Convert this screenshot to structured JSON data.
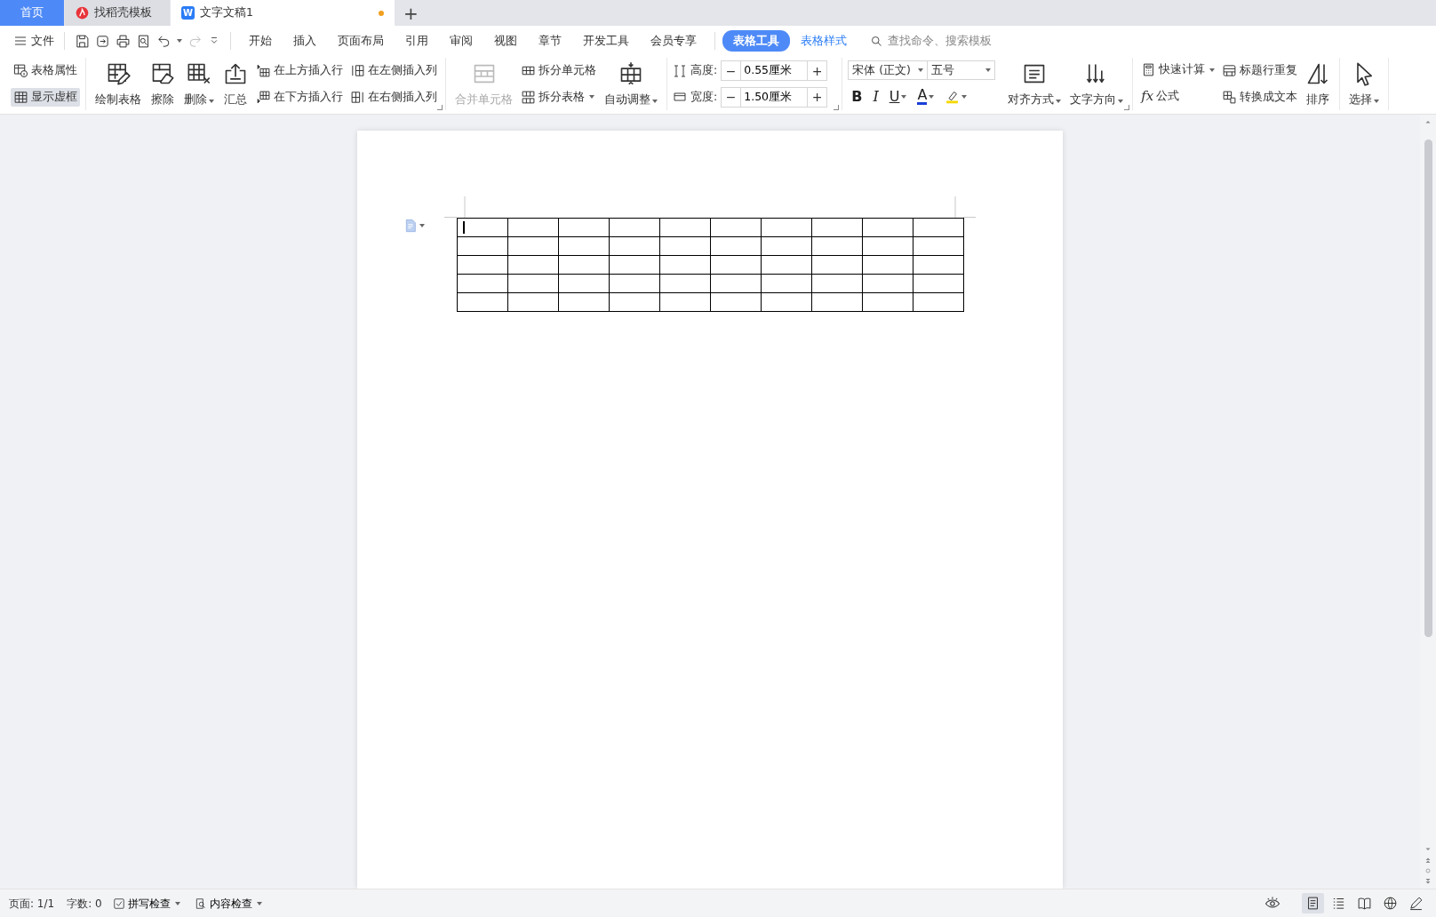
{
  "tabs": [
    {
      "kind": "home",
      "label": "首页",
      "selected": false
    },
    {
      "kind": "template",
      "label": "找稻壳模板",
      "selected": false
    },
    {
      "kind": "doc",
      "label": "文字文稿1",
      "logo": "W",
      "modified": true,
      "selected": true
    }
  ],
  "new_tab": "+",
  "file_menu": "文件",
  "menu_tabs": [
    {
      "kind": "normal",
      "label": "开始",
      "selected": false
    },
    {
      "kind": "normal",
      "label": "插入",
      "selected": false
    },
    {
      "kind": "normal",
      "label": "页面布局",
      "selected": false
    },
    {
      "kind": "normal",
      "label": "引用",
      "selected": false
    },
    {
      "kind": "normal",
      "label": "审阅",
      "selected": false
    },
    {
      "kind": "normal",
      "label": "视图",
      "selected": false
    },
    {
      "kind": "normal",
      "label": "章节",
      "selected": false
    },
    {
      "kind": "normal",
      "label": "开发工具",
      "selected": false
    },
    {
      "kind": "normal",
      "label": "会员专享",
      "selected": false
    },
    {
      "kind": "context",
      "label": "表格工具",
      "selected": true
    },
    {
      "kind": "context",
      "label": "表格样式",
      "selected": false
    }
  ],
  "search": {
    "placeholder": "查找命令、搜索模板"
  },
  "ribbon": [
    {
      "launcher": false,
      "items": [
        {
          "kind": "stack",
          "buttons": [
            {
              "label": "表格属性",
              "on": false
            },
            {
              "label": "显示虚框",
              "on": true
            }
          ]
        }
      ]
    },
    {
      "launcher": true,
      "items": [
        {
          "kind": "large",
          "label": "绘制表格",
          "dropdown": false
        },
        {
          "kind": "large",
          "label": "擦除",
          "dropdown": false
        },
        {
          "kind": "large",
          "label": "删除",
          "dropdown": true
        },
        {
          "kind": "large",
          "label": "汇总",
          "dropdown": false
        },
        {
          "kind": "stack",
          "buttons": [
            {
              "label": "在上方插入行",
              "dropdown": false
            },
            {
              "label": "在下方插入行",
              "dropdown": false
            }
          ]
        },
        {
          "kind": "stack",
          "buttons": [
            {
              "label": "在左侧插入列",
              "dropdown": false
            },
            {
              "label": "在右侧插入列",
              "dropdown": false
            }
          ]
        }
      ]
    },
    {
      "launcher": false,
      "items": [
        {
          "kind": "large",
          "label": "合并单元格",
          "dropdown": false,
          "disabled": true
        },
        {
          "kind": "stack",
          "buttons": [
            {
              "label": "拆分单元格",
              "dropdown": false,
              "disabled": false
            },
            {
              "label": "拆分表格",
              "dropdown": true,
              "disabled": false
            }
          ]
        },
        {
          "kind": "large",
          "label": "自动调整",
          "dropdown": true,
          "disabled": false
        }
      ]
    },
    {
      "launcher": true,
      "items": [
        {
          "kind": "spinners",
          "rows": [
            {
              "label": "高度:",
              "value": "0.55厘米",
              "minus": "−",
              "plus": "+"
            },
            {
              "label": "宽度:",
              "value": "1.50厘米",
              "minus": "−",
              "plus": "+"
            }
          ]
        }
      ]
    },
    {
      "launcher": true,
      "items": [
        {
          "kind": "font",
          "font": "宋体 (正文)",
          "size": "五号",
          "styles": [
            {
              "glyph": "B",
              "dropdown": false
            },
            {
              "glyph": "I",
              "dropdown": false
            },
            {
              "glyph": "U",
              "dropdown": true
            },
            {
              "glyph": "A",
              "dropdown": true
            }
          ],
          "highlight_dropdown": true
        },
        {
          "kind": "large",
          "label": "对齐方式",
          "dropdown": true
        },
        {
          "kind": "large",
          "label": "文字方向",
          "dropdown": true
        }
      ]
    },
    {
      "launcher": false,
      "items": [
        {
          "kind": "stack",
          "buttons": [
            {
              "label": "快速计算",
              "dropdown": true
            },
            {
              "label": "公式",
              "glyph": "fx",
              "dropdown": false
            }
          ]
        },
        {
          "kind": "stack",
          "buttons": [
            {
              "label": "标题行重复",
              "dropdown": false
            },
            {
              "label": "转换成文本",
              "dropdown": false
            }
          ]
        },
        {
          "kind": "large",
          "label": "排序",
          "dropdown": false
        }
      ]
    },
    {
      "launcher": false,
      "items": [
        {
          "kind": "large",
          "label": "选择",
          "dropdown": true
        }
      ]
    }
  ],
  "table": {
    "rows": [
      {
        "cells": [
          {
            "cursor": true
          },
          {
            "cursor": false
          },
          {
            "cursor": false
          },
          {
            "cursor": false
          },
          {
            "cursor": false
          },
          {
            "cursor": false
          },
          {
            "cursor": false
          },
          {
            "cursor": false
          },
          {
            "cursor": false
          },
          {
            "cursor": false
          }
        ]
      },
      {
        "cells": [
          {
            "cursor": false
          },
          {
            "cursor": false
          },
          {
            "cursor": false
          },
          {
            "cursor": false
          },
          {
            "cursor": false
          },
          {
            "cursor": false
          },
          {
            "cursor": false
          },
          {
            "cursor": false
          },
          {
            "cursor": false
          },
          {
            "cursor": false
          }
        ]
      },
      {
        "cells": [
          {
            "cursor": false
          },
          {
            "cursor": false
          },
          {
            "cursor": false
          },
          {
            "cursor": false
          },
          {
            "cursor": false
          },
          {
            "cursor": false
          },
          {
            "cursor": false
          },
          {
            "cursor": false
          },
          {
            "cursor": false
          },
          {
            "cursor": false
          }
        ]
      },
      {
        "cells": [
          {
            "cursor": false
          },
          {
            "cursor": false
          },
          {
            "cursor": false
          },
          {
            "cursor": false
          },
          {
            "cursor": false
          },
          {
            "cursor": false
          },
          {
            "cursor": false
          },
          {
            "cursor": false
          },
          {
            "cursor": false
          },
          {
            "cursor": false
          }
        ]
      },
      {
        "cells": [
          {
            "cursor": false
          },
          {
            "cursor": false
          },
          {
            "cursor": false
          },
          {
            "cursor": false
          },
          {
            "cursor": false
          },
          {
            "cursor": false
          },
          {
            "cursor": false
          },
          {
            "cursor": false
          },
          {
            "cursor": false
          },
          {
            "cursor": false
          }
        ]
      }
    ]
  },
  "status_bar": {
    "page": "页面: 1/1",
    "words": "字数: 0",
    "checks": [
      {
        "label": "拼写检查",
        "dropdown": true
      },
      {
        "label": "内容检查",
        "dropdown": true
      }
    ],
    "views": [
      {
        "selected": true
      },
      {
        "selected": false
      },
      {
        "selected": false
      },
      {
        "selected": false
      },
      {
        "selected": false
      }
    ]
  }
}
